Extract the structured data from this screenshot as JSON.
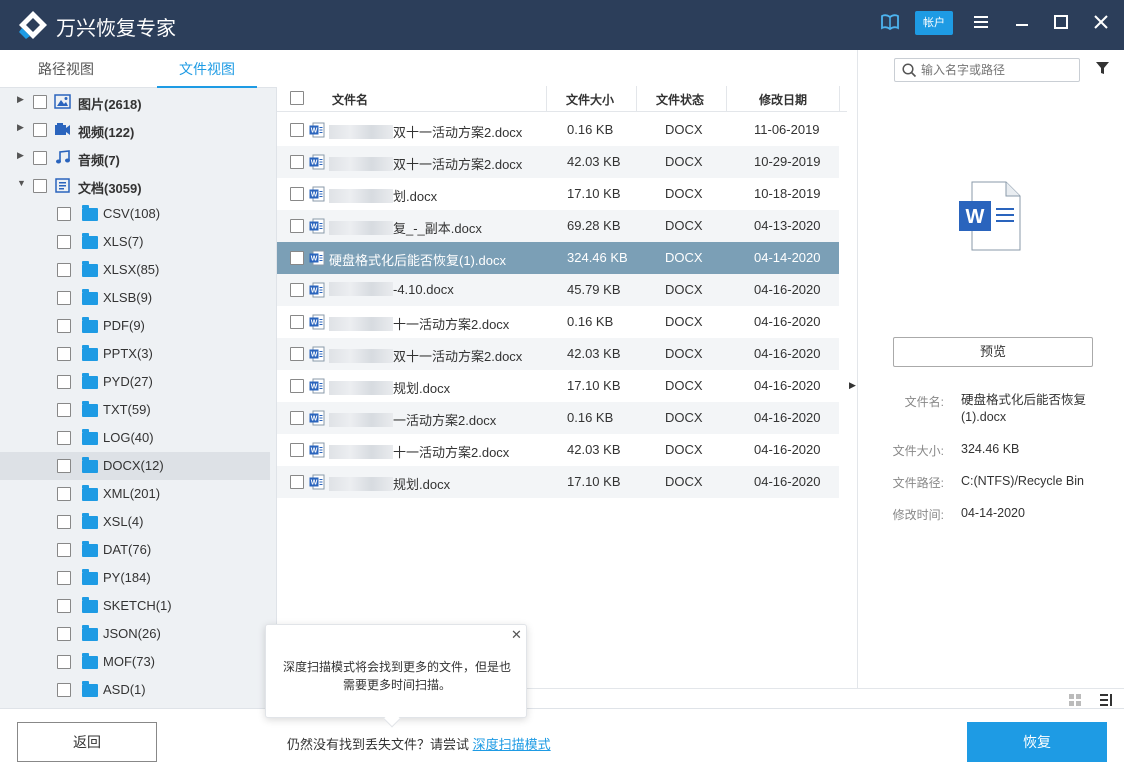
{
  "app": {
    "title": "万兴恢复专家",
    "account_label": "帐户"
  },
  "left_tabs": [
    "路径视图",
    "文件视图"
  ],
  "tree": [
    {
      "label": "图片(2618)",
      "bold": true,
      "icon": "image-icon",
      "expanded": false
    },
    {
      "label": "视频(122)",
      "bold": true,
      "icon": "video-icon",
      "expanded": false
    },
    {
      "label": "音频(7)",
      "bold": true,
      "icon": "music-icon",
      "expanded": false
    },
    {
      "label": "文档(3059)",
      "bold": true,
      "icon": "document-icon",
      "expanded": true
    }
  ],
  "doc_types": [
    "CSV(108)",
    "XLS(7)",
    "XLSX(85)",
    "XLSB(9)",
    "PDF(9)",
    "PPTX(3)",
    "PYD(27)",
    "TXT(59)",
    "LOG(40)",
    "DOCX(12)",
    "XML(201)",
    "XSL(4)",
    "DAT(76)",
    "PY(184)",
    "SKETCH(1)",
    "JSON(26)",
    "MOF(73)",
    "ASD(1)"
  ],
  "selected_doc_type": "DOCX(12)",
  "table": {
    "headers": {
      "name": "文件名",
      "size": "文件大小",
      "status": "文件状态",
      "date": "修改日期"
    },
    "rows": [
      {
        "name": "双十一活动方案2.docx",
        "size": "0.16  KB",
        "status": "DOCX",
        "date": "11-06-2019",
        "blurred": true
      },
      {
        "name": "双十一活动方案2.docx",
        "size": "42.03  KB",
        "status": "DOCX",
        "date": "10-29-2019",
        "blurred": true
      },
      {
        "name": "划.docx",
        "size": "17.10  KB",
        "status": "DOCX",
        "date": "10-18-2019",
        "blurred": true
      },
      {
        "name": "复_-_副本.docx",
        "size": "69.28  KB",
        "status": "DOCX",
        "date": "04-13-2020",
        "blurred": true
      },
      {
        "name": "硬盘格式化后能否恢复(1).docx",
        "size": "324.46  KB",
        "status": "DOCX",
        "date": "04-14-2020",
        "blurred": false
      },
      {
        "name": "-4.10.docx",
        "size": "45.79  KB",
        "status": "DOCX",
        "date": "04-16-2020",
        "blurred": true
      },
      {
        "name": "十一活动方案2.docx",
        "size": "0.16  KB",
        "status": "DOCX",
        "date": "04-16-2020",
        "blurred": true
      },
      {
        "name": "双十一活动方案2.docx",
        "size": "42.03  KB",
        "status": "DOCX",
        "date": "04-16-2020",
        "blurred": true
      },
      {
        "name": "规划.docx",
        "size": "17.10  KB",
        "status": "DOCX",
        "date": "04-16-2020",
        "blurred": true
      },
      {
        "name": "一活动方案2.docx",
        "size": "0.16  KB",
        "status": "DOCX",
        "date": "04-16-2020",
        "blurred": true
      },
      {
        "name": "十一活动方案2.docx",
        "size": "42.03  KB",
        "status": "DOCX",
        "date": "04-16-2020",
        "blurred": true
      },
      {
        "name": "规划.docx",
        "size": "17.10  KB",
        "status": "DOCX",
        "date": "04-16-2020",
        "blurred": true
      }
    ],
    "selected_row": 4
  },
  "search": {
    "placeholder": "输入名字或路径"
  },
  "preview": {
    "button_label": "预览",
    "info": [
      {
        "label": "文件名:",
        "value": "硬盘格式化后能否恢复(1).docx"
      },
      {
        "label": "文件大小:",
        "value": "324.46   KB"
      },
      {
        "label": "文件路径:",
        "value": "C:(NTFS)/Recycle Bin"
      },
      {
        "label": "修改时间:",
        "value": "04-14-2020"
      }
    ]
  },
  "popup": {
    "text": "深度扫描模式将会找到更多的文件，但是也需要更多时间扫描。"
  },
  "bottom": {
    "back_label": "返回",
    "hint_text": "仍然没有找到丢失文件？请尝试 ",
    "hint_link": "深度扫描模式",
    "recover_label": "恢复"
  },
  "colors": {
    "titlebar": "#2c3e5a",
    "accent": "#1e9be4",
    "selected_row": "#7b9fb6"
  }
}
